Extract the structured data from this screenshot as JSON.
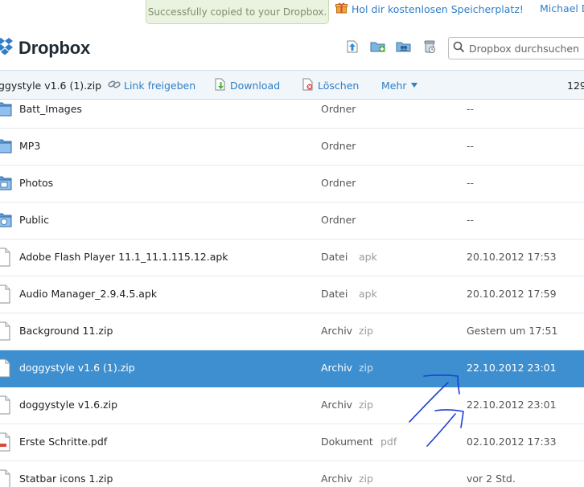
{
  "toast": {
    "message": "Successfully copied to your Dropbox."
  },
  "promo": {
    "link_text": "Hol dir kostenlosen Speicherplatz!",
    "icon": "gift-icon"
  },
  "user": {
    "name": "Michael D"
  },
  "header": {
    "logo_text": "Dropbox",
    "icons": [
      "upload-icon",
      "new-folder-icon",
      "share-folder-icon",
      "deleted-files-icon"
    ],
    "search": {
      "placeholder": "Dropbox durchsuchen",
      "value": ""
    }
  },
  "actionbar": {
    "file_name": "ggystyle v1.6 (1).zip",
    "share_label": "Link freigeben",
    "download_label": "Download",
    "delete_label": "Löschen",
    "more_label": "Mehr",
    "count_text": "129"
  },
  "files": [
    {
      "name": "Batt_Images",
      "kind": "Ordner",
      "ext": "",
      "date": "--",
      "icon": "folder-icon"
    },
    {
      "name": "MP3",
      "kind": "Ordner",
      "ext": "",
      "date": "--",
      "icon": "folder-icon"
    },
    {
      "name": "Photos",
      "kind": "Ordner",
      "ext": "",
      "date": "--",
      "icon": "photos-folder-icon"
    },
    {
      "name": "Public",
      "kind": "Ordner",
      "ext": "",
      "date": "--",
      "icon": "public-folder-icon"
    },
    {
      "name": "Adobe Flash Player 11.1_11.1.115.12.apk",
      "kind": "Datei",
      "ext": "apk",
      "date": "20.10.2012 17:53",
      "icon": "file-icon"
    },
    {
      "name": "Audio Manager_2.9.4.5.apk",
      "kind": "Datei",
      "ext": "apk",
      "date": "20.10.2012 17:59",
      "icon": "file-icon"
    },
    {
      "name": "Background 11.zip",
      "kind": "Archiv",
      "ext": "zip",
      "date": "Gestern um 17:51",
      "icon": "zip-file-icon"
    },
    {
      "name": "doggystyle v1.6 (1).zip",
      "kind": "Archiv",
      "ext": "zip",
      "date": "22.10.2012 23:01",
      "icon": "zip-file-icon",
      "selected": true
    },
    {
      "name": "doggystyle v1.6.zip",
      "kind": "Archiv",
      "ext": "zip",
      "date": "22.10.2012 23:01",
      "icon": "zip-file-icon"
    },
    {
      "name": "Erste Schritte.pdf",
      "kind": "Dokument",
      "ext": "pdf",
      "date": "02.10.2012 17:33",
      "icon": "pdf-file-icon"
    },
    {
      "name": "Statbar icons 1.zip",
      "kind": "Archiv",
      "ext": "zip",
      "date": "vor 2 Std.",
      "icon": "zip-file-icon"
    }
  ],
  "colors": {
    "accent": "#2f7ec6",
    "selected_row": "#3d8fd0",
    "toast_bg": "#eaf2e0",
    "annotation": "#1f3fd6"
  }
}
